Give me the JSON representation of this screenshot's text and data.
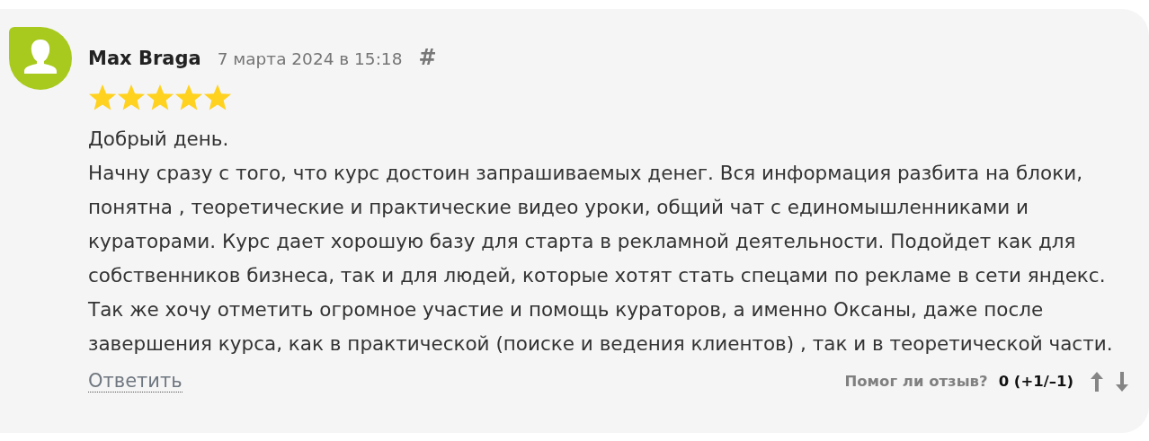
{
  "review": {
    "author": "Max Braga",
    "date": "7 марта 2024 в 15:18",
    "anchor": "#",
    "stars": 5,
    "paragraphs": [
      [
        "Добрый день."
      ],
      [
        "Начну сразу с того, что курс достоин запрашиваемых денег. Вся информация разбита на блоки,",
        "понятна , теоретические и практические видео уроки, общий чат с единомышленниками и",
        "кураторами. Курс дает хорошую базу для старта в рекламной деятельности. Подойдет как для",
        "собственников бизнеса, так и для людей, которые хотят стать спецами по рекламе в сети яндекс.",
        "Так же хочу отметить огромное участие и помощь кураторов, а именно Оксаны, даже после",
        "завершения курса, как в практической (поиске и ведения клиентов) , так и в теоретической части."
      ]
    ],
    "reply": "Ответить",
    "helpful_label": "Помог ли отзыв?",
    "score": "0 (+1/–1)"
  }
}
